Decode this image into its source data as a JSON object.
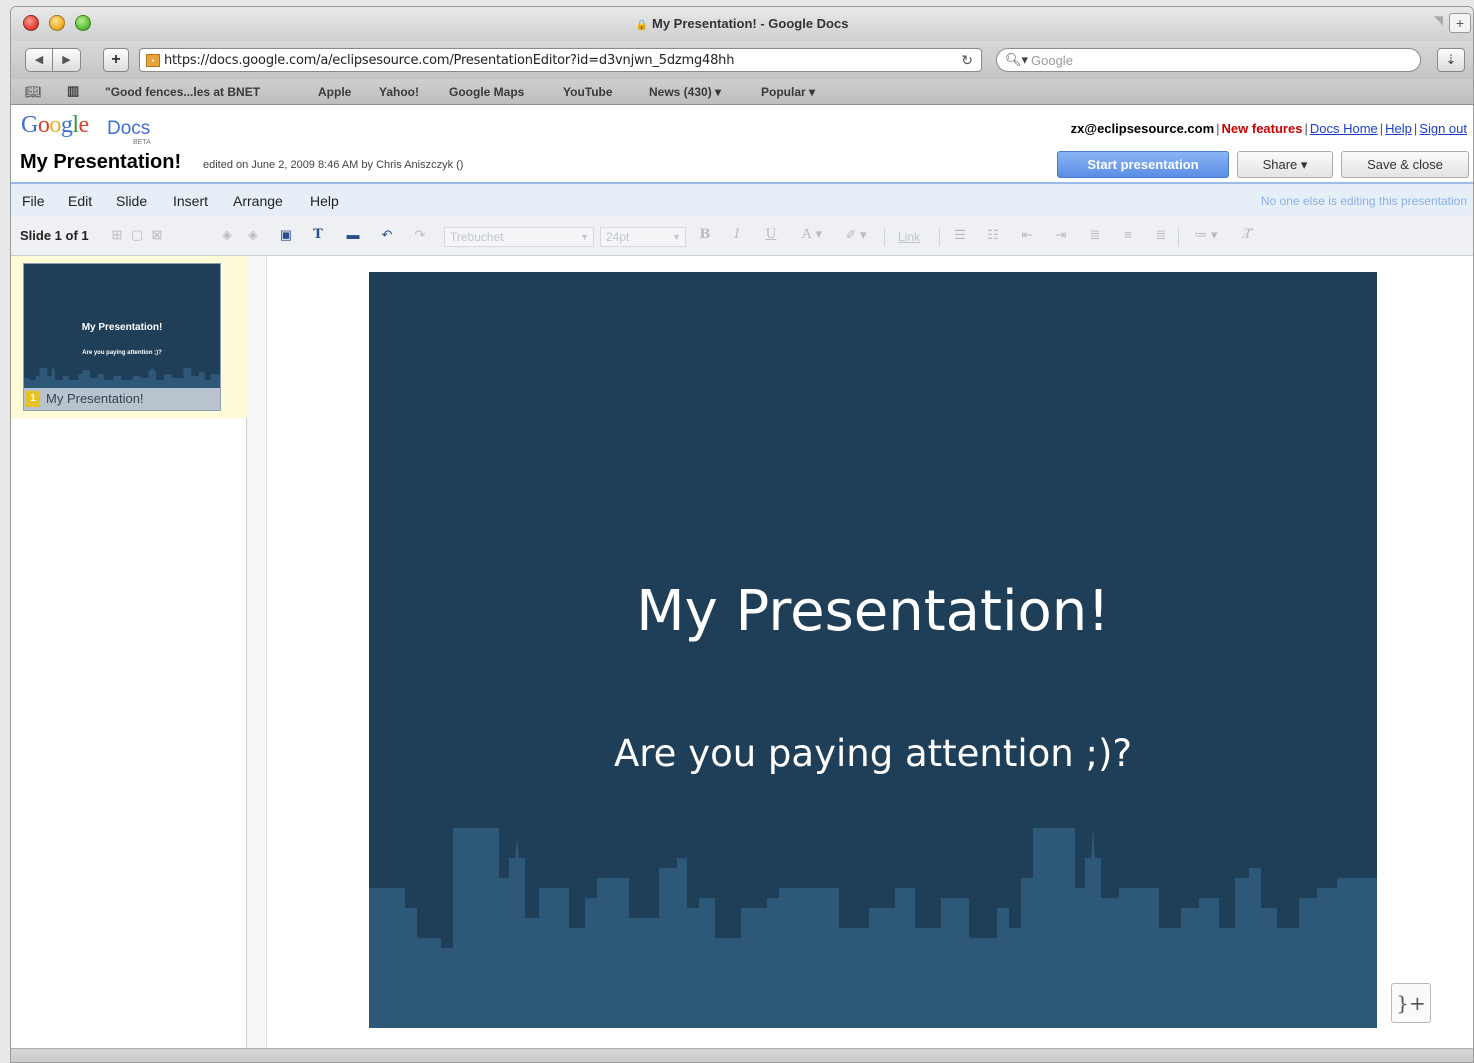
{
  "browser": {
    "window_title": "My Presentation! - Google Docs",
    "url": "https://docs.google.com/a/eclipsesource.com/PresentationEditor?id=d3vnjwn_5dzmg48hh",
    "search_placeholder": "Google",
    "bookmarks": [
      "\"Good fences...les at BNET",
      "Apple",
      "Yahoo!",
      "Google Maps",
      "YouTube",
      "News (430) ▾",
      "Popular ▾"
    ]
  },
  "header": {
    "logo_docs": "Docs",
    "logo_beta": "BETA",
    "user_email": "zx@eclipsesource.com",
    "new_features": "New features",
    "docs_home": "Docs Home",
    "help": "Help",
    "sign_out": "Sign out",
    "doc_title": "My Presentation!",
    "edited_text": "edited on June 2, 2009 8:46 AM by Chris Aniszczyk ()",
    "start_presentation": "Start presentation",
    "share": "Share ▾",
    "save_close": "Save & close"
  },
  "menu": {
    "items": [
      "File",
      "Edit",
      "Slide",
      "Insert",
      "Arrange",
      "Help"
    ],
    "status": "No one else is editing this presentation"
  },
  "toolbar": {
    "slide_count": "Slide 1 of 1",
    "font": "Trebuchet",
    "size": "24pt",
    "link": "Link"
  },
  "sidebar": {
    "slides": [
      {
        "number": "1",
        "name": "My Presentation!",
        "title": "My Presentation!",
        "subtitle": "Are you paying attention ;)?"
      }
    ]
  },
  "slide": {
    "title": "My Presentation!",
    "subtitle": "Are you paying attention ;)?",
    "background": "#1f3f58",
    "skyline_color": "#2e5878"
  }
}
